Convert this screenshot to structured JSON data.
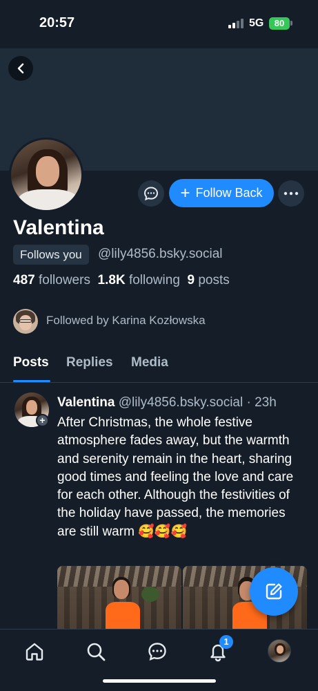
{
  "status_bar": {
    "time": "20:57",
    "network": "5G",
    "battery": "80"
  },
  "profile": {
    "display_name": "Valentina",
    "follows_you_badge": "Follows you",
    "handle": "@lily4856.bsky.social",
    "followers_count": "487",
    "followers_label": "followers",
    "following_count": "1.8K",
    "following_label": "following",
    "posts_count": "9",
    "posts_label": "posts",
    "followed_by_text": "Followed by Karina Kozłowska"
  },
  "actions": {
    "follow_back_label": "Follow Back",
    "follow_back_icon": "+"
  },
  "tabs": [
    {
      "label": "Posts",
      "active": true
    },
    {
      "label": "Replies",
      "active": false
    },
    {
      "label": "Media",
      "active": false
    }
  ],
  "post": {
    "author": "Valentina",
    "handle": "@lily4856.bsky.social",
    "separator": "·",
    "time": "23h",
    "text": "After Christmas, the whole festive atmosphere fades away, but the warmth and serenity remain in the heart, sharing good times and feeling the love and care for each other. Although the festivities of the holiday have passed, the memories are still warm 🥰🥰🥰",
    "avatar_plus": "+"
  },
  "bottom_nav": {
    "items": [
      "home-icon",
      "search-icon",
      "chat-icon",
      "bell-icon",
      "avatar"
    ],
    "notification_badge": "1"
  },
  "colors": {
    "background": "#151d28",
    "banner": "#1f2c3a",
    "accent": "#208bfe",
    "muted_text": "#aebbc9",
    "chip": "#263342"
  }
}
